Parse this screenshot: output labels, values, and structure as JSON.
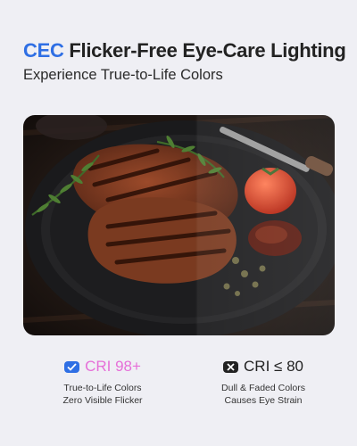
{
  "header": {
    "title_brand": "CEC",
    "title_rest": "Flicker-Free Eye-Care Lighting",
    "subtitle": "Experience True-to-Life Colors"
  },
  "photo": {
    "subject": "grilled-steak-plate"
  },
  "comparison": {
    "good": {
      "icon": "check-badge-icon",
      "label": "CRI 98+",
      "lines": [
        "True-to-Life Colors",
        "Zero Visible Flicker"
      ],
      "color": "#e66fd8",
      "icon_color": "#2f6fe4"
    },
    "bad": {
      "icon": "x-badge-icon",
      "label": "CRI ≤ 80",
      "lines": [
        "Dull & Faded Colors",
        "Causes Eye Strain"
      ],
      "color": "#222222",
      "icon_color": "#222222"
    }
  }
}
